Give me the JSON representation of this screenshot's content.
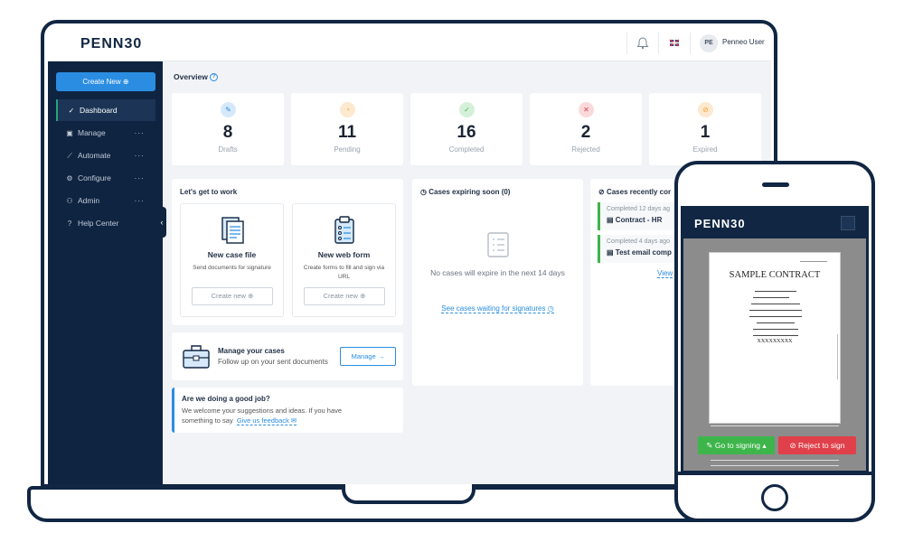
{
  "app": {
    "logo": "PENN30",
    "user_initials": "PE",
    "user_name": "Penneo User"
  },
  "sidebar": {
    "create_label": "Create New",
    "items": [
      {
        "label": "Dashboard",
        "icon": "check-circle-icon",
        "active": true
      },
      {
        "label": "Manage",
        "icon": "briefcase-icon",
        "dots": "···"
      },
      {
        "label": "Automate",
        "icon": "magic-wand-icon",
        "dots": "···"
      },
      {
        "label": "Configure",
        "icon": "gear-icon",
        "dots": "···"
      },
      {
        "label": "Admin",
        "icon": "users-icon",
        "dots": "···"
      },
      {
        "label": "Help Center",
        "icon": "question-icon"
      }
    ]
  },
  "overview": {
    "title": "Overview",
    "stats": [
      {
        "value": "8",
        "label": "Drafts",
        "color": "#2a8de2",
        "icon": "pencil-icon"
      },
      {
        "value": "11",
        "label": "Pending",
        "color": "#f2a23c",
        "icon": "clock-icon"
      },
      {
        "value": "16",
        "label": "Completed",
        "color": "#3db54a",
        "icon": "check-icon"
      },
      {
        "value": "2",
        "label": "Rejected",
        "color": "#e0404a",
        "icon": "x-icon"
      },
      {
        "value": "1",
        "label": "Expired",
        "color": "#f2a23c",
        "icon": "expired-icon"
      }
    ]
  },
  "work": {
    "title": "Let's get to work",
    "case_file": {
      "title": "New case file",
      "desc": "Send documents for signature",
      "button": "Create new"
    },
    "web_form": {
      "title": "New web form",
      "desc": "Create forms to fill and sign via URL",
      "button": "Create new"
    }
  },
  "manage": {
    "title": "Manage your cases",
    "desc": "Follow up on your sent documents",
    "button": "Manage"
  },
  "feedback": {
    "title": "Are we doing a good job?",
    "text": "We welcome your suggestions and ideas. If you have something to say",
    "link": "Give us feedback"
  },
  "expiring": {
    "title": "Cases expiring soon (0)",
    "empty": "No cases will expire in the next 14 days",
    "link": "See cases waiting for signatures"
  },
  "recent": {
    "title": "Cases recently cor",
    "items": [
      {
        "meta": "Completed 12 days ag",
        "name": "Contract - HR"
      },
      {
        "meta": "Completed 4 days ago",
        "name": "Test email comp"
      }
    ],
    "link": "View"
  },
  "phone": {
    "logo": "PENN30",
    "contract_title": "SAMPLE CONTRACT",
    "contract_line": "XXXXXXXXX",
    "go_button": "Go to signing",
    "reject_button": "Reject to sign"
  }
}
